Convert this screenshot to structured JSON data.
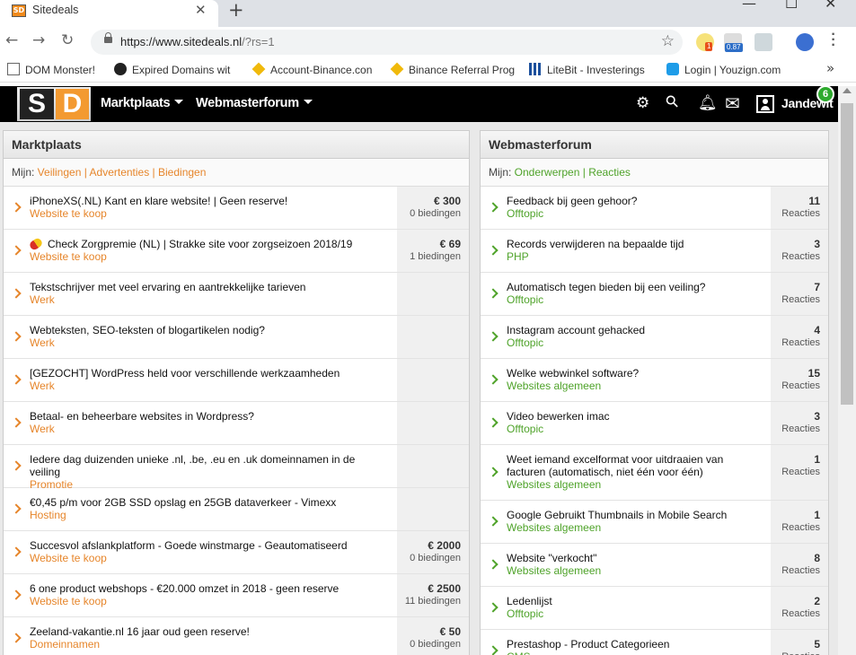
{
  "browser": {
    "tab_title": "Sitedeals",
    "favicon_text": "SD",
    "url_main": "https://www.sitedeals.nl",
    "url_path": "/?rs=1",
    "extension_badges": [
      "1",
      "0.87"
    ],
    "bookmarks": [
      {
        "label": "DOM Monster!",
        "icon": "page-icon"
      },
      {
        "label": "Expired Domains wit",
        "icon": "circle-icon"
      },
      {
        "label": "Account-Binance.con",
        "icon": "binance-icon"
      },
      {
        "label": "Binance Referral Prog",
        "icon": "binance-icon"
      },
      {
        "label": "LiteBit - Investerings",
        "icon": "grid-icon"
      },
      {
        "label": "Login | Youzign.com",
        "icon": "youzign-icon"
      }
    ]
  },
  "site": {
    "logo_s": "S",
    "logo_d": "D",
    "nav": [
      "Marktplaats",
      "Webmasterforum"
    ],
    "username": "Jandewit",
    "notification_count": "6"
  },
  "marktplaats": {
    "title": "Marktplaats",
    "mine_label": "Mijn: ",
    "links": [
      "Veilingen",
      "Advertenties",
      "Biedingen"
    ],
    "items": [
      {
        "title": "iPhoneXS(.NL) Kant en klare website! | Geen reserve!",
        "category": "Website te koop",
        "price": "€ 300",
        "bids": "0 biedingen"
      },
      {
        "title": "Check Zorgpremie (NL) | Strakke site voor zorgseizoen 2018/19",
        "category": "Website te koop",
        "price": "€ 69",
        "bids": "1 biedingen",
        "pill": true
      },
      {
        "title": "Tekstschrijver met veel ervaring en aantrekkelijke tarieven",
        "category": "Werk",
        "price": "",
        "bids": ""
      },
      {
        "title": "Webteksten, SEO-teksten of blogartikelen nodig?",
        "category": "Werk",
        "price": "",
        "bids": ""
      },
      {
        "title": "[GEZOCHT] WordPress held voor verschillende werkzaamheden",
        "category": "Werk",
        "price": "",
        "bids": ""
      },
      {
        "title": "Betaal- en beheerbare websites in Wordpress?",
        "category": "Werk",
        "price": "",
        "bids": ""
      },
      {
        "title": "Iedere dag duizenden unieke .nl, .be, .eu en .uk domeinnamen in de veiling",
        "category": "Promotie",
        "price": "",
        "bids": ""
      },
      {
        "title": "€0,45 p/m voor 2GB SSD opslag en 25GB dataverkeer - Vimexx",
        "category": "Hosting",
        "price": "",
        "bids": ""
      },
      {
        "title": "Succesvol afslankplatform - Goede winstmarge - Geautomatiseerd",
        "category": "Website te koop",
        "price": "€ 2000",
        "bids": "0 biedingen"
      },
      {
        "title": "6 one product webshops - €20.000 omzet in 2018 - geen reserve",
        "category": "Website te koop",
        "price": "€ 2500",
        "bids": "11 biedingen"
      },
      {
        "title": "Zeeland-vakantie.nl 16 jaar oud geen reserve!",
        "category": "Domeinnamen",
        "price": "€ 50",
        "bids": "0 biedingen"
      }
    ]
  },
  "forum": {
    "title": "Webmasterforum",
    "mine_label": "Mijn: ",
    "links": [
      "Onderwerpen",
      "Reacties"
    ],
    "reacties_label": "Reacties",
    "items": [
      {
        "title": "Feedback bij geen gehoor?",
        "category": "Offtopic",
        "count": "11"
      },
      {
        "title": "Records verwijderen na bepaalde tijd",
        "category": "PHP",
        "count": "3"
      },
      {
        "title": "Automatisch tegen bieden bij een veiling?",
        "category": "Offtopic",
        "count": "7"
      },
      {
        "title": "Instagram account gehacked",
        "category": "Offtopic",
        "count": "4"
      },
      {
        "title": "Welke webwinkel software?",
        "category": "Websites algemeen",
        "count": "15"
      },
      {
        "title": "Video bewerken imac",
        "category": "Offtopic",
        "count": "3"
      },
      {
        "title": "Weet iemand excelformat voor uitdraaien van facturen (automatisch, niet één voor één)",
        "category": "Websites algemeen",
        "count": "1",
        "tall": true
      },
      {
        "title": "Google Gebruikt Thumbnails in Mobile Search",
        "category": "Websites algemeen",
        "count": "1"
      },
      {
        "title": "Website \"verkocht\"",
        "category": "Websites algemeen",
        "count": "8"
      },
      {
        "title": "Ledenlijst",
        "category": "Offtopic",
        "count": "2"
      },
      {
        "title": "Prestashop - Product Categorieen",
        "category": "CMS",
        "count": "5"
      }
    ]
  },
  "colors": {
    "accent_orange": "#e6852a",
    "accent_green": "#4fa32a",
    "header_bg": "#000000"
  }
}
